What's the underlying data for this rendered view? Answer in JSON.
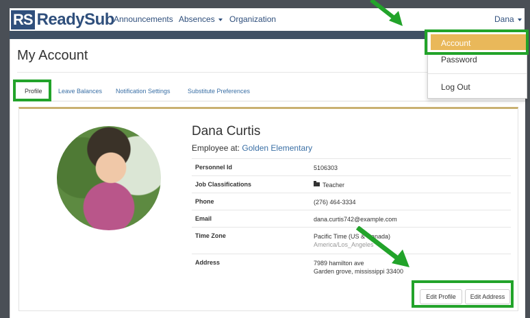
{
  "brand": {
    "logo_mark": "RS",
    "logo_text": "ReadySub"
  },
  "nav": {
    "items": [
      "Announcements",
      "Absences",
      "Organization"
    ],
    "user": "Dana"
  },
  "user_menu": {
    "items": [
      "Account",
      "Password",
      "Log Out"
    ],
    "active": "Account"
  },
  "page": {
    "title": "My Account",
    "tabs": [
      "Profile",
      "Leave Balances",
      "Notification Settings",
      "Substitute Preferences"
    ],
    "active_tab": "Profile"
  },
  "profile": {
    "name": "Dana Curtis",
    "employee_prefix": "Employee at:",
    "employee_school": "Golden Elementary",
    "fields": [
      {
        "label": "Personnel Id",
        "value": "5106303"
      },
      {
        "label": "Job Classifications",
        "value": "Teacher",
        "icon": "folder-icon"
      },
      {
        "label": "Phone",
        "value": "(276) 464-3334"
      },
      {
        "label": "Email",
        "value": "dana.curtis742@example.com"
      },
      {
        "label": "Time Zone",
        "value": "Pacific Time (US & Canada)",
        "sub": "America/Los_Angeles"
      },
      {
        "label": "Address",
        "value": "7989 hamilton ave",
        "sub": "Garden grove, mississippi 33400"
      }
    ]
  },
  "actions": {
    "edit_profile": "Edit Profile",
    "edit_address": "Edit Address"
  },
  "colors": {
    "brand_blue": "#2f4f7c",
    "nav_dark": "#3e4f63",
    "accent_gold": "#c9b070",
    "menu_active": "#e9b85a",
    "highlight_green": "#22a32a",
    "link_blue": "#3a6fa5"
  }
}
